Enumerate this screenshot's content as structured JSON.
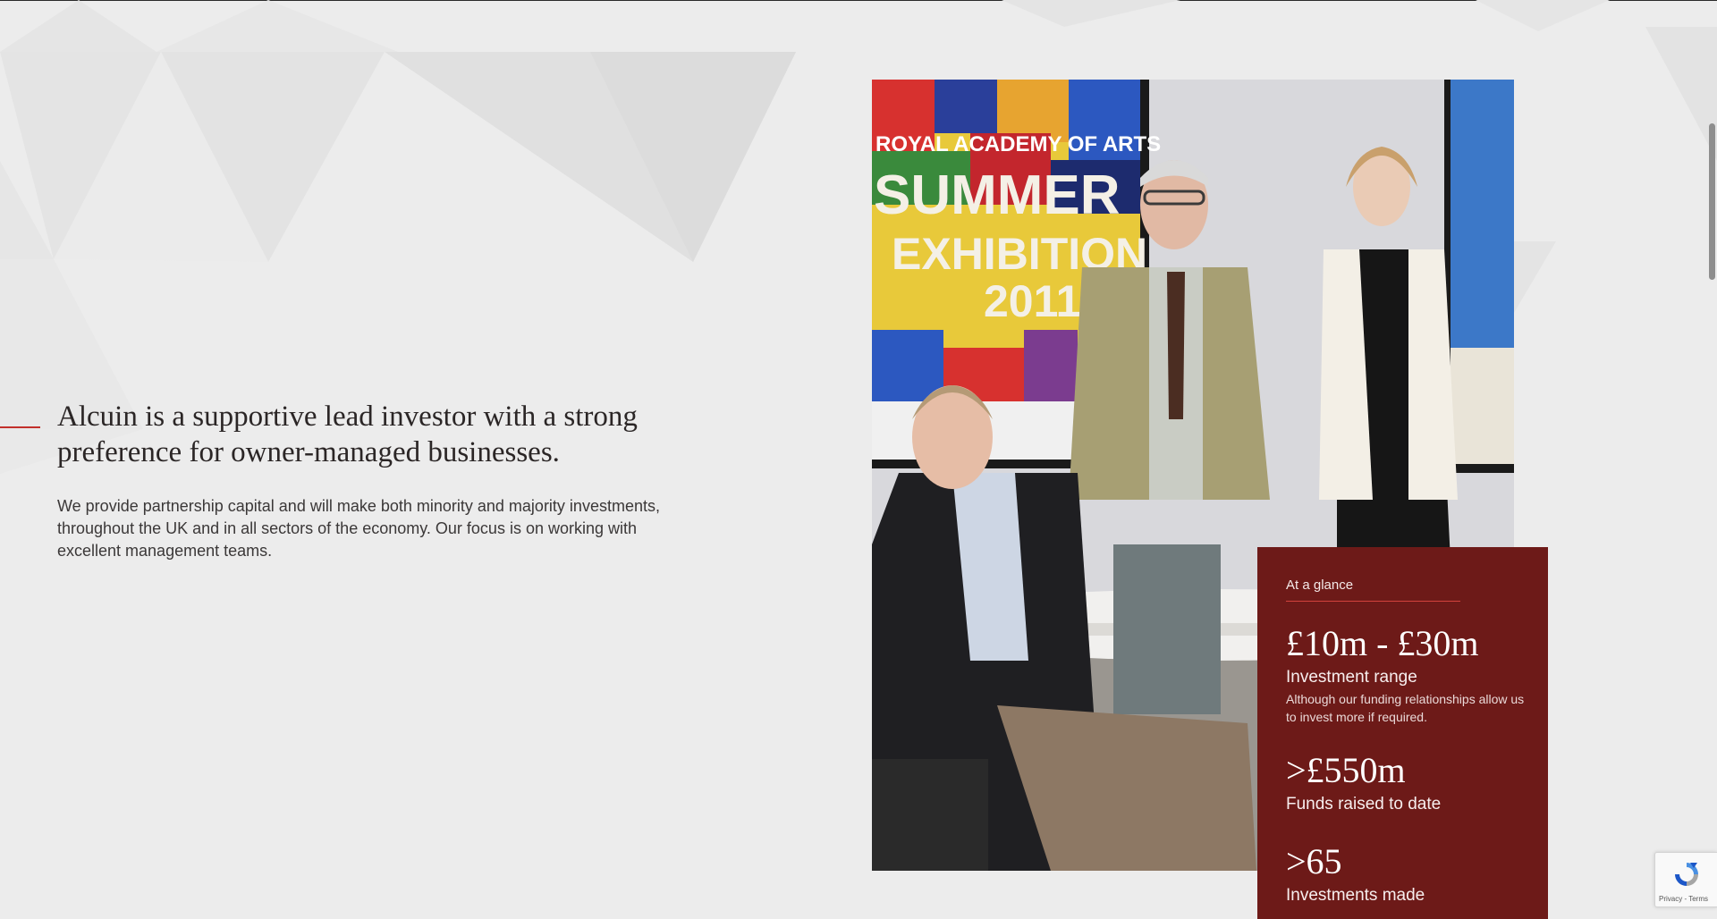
{
  "intro": {
    "heading": "Alcuin is a supportive lead investor with a strong preference for owner-managed businesses.",
    "body": "We provide partnership capital and will make both minority and majority investments, throughout the UK and in all sectors of the economy. Our focus is on working with excellent management teams."
  },
  "photo": {
    "poster_lines": [
      "ROYAL ACADEMY OF ARTS",
      "SUMMER",
      "EXHIBITION",
      "2011"
    ]
  },
  "glance": {
    "label": "At a glance",
    "stats": [
      {
        "value": "£10m - £30m",
        "label": "Investment range",
        "note": "Although our funding relationships allow us to invest more if required."
      },
      {
        "value": ">£550m",
        "label": "Funds raised to date"
      },
      {
        "value": ">65",
        "label": "Investments made"
      }
    ]
  },
  "recaptcha": {
    "privacy": "Privacy",
    "separator": " - ",
    "terms": "Terms"
  },
  "colors": {
    "accent_red": "#c2302b",
    "panel_maroon": "#6d1a18",
    "page_background": "#ececec"
  }
}
